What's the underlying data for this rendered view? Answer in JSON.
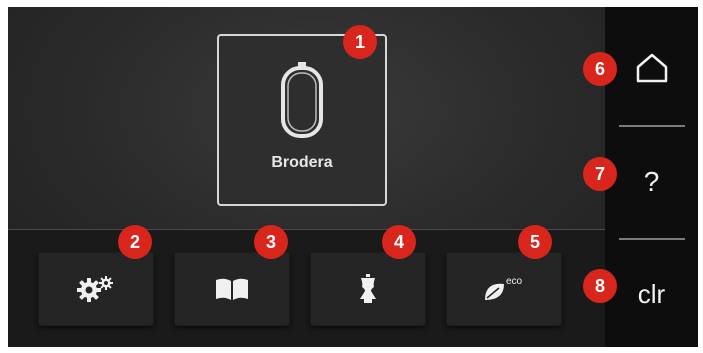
{
  "main_tile": {
    "label": "Brodera",
    "icon": "embroidery-hoop-icon"
  },
  "toolbar": [
    {
      "icon": "settings-gears-icon"
    },
    {
      "icon": "open-book-icon"
    },
    {
      "icon": "dress-form-icon"
    },
    {
      "icon": "eco-leaf-icon",
      "eco_label": "eco"
    }
  ],
  "sidebar": {
    "home_icon": "home-icon",
    "help_label": "?",
    "clear_label": "clr"
  },
  "badges": [
    "1",
    "2",
    "3",
    "4",
    "5",
    "6",
    "7",
    "8"
  ],
  "colors": {
    "badge": "#d9261c",
    "background": "#2a2a2a",
    "sidebar": "#0d0d0d"
  }
}
